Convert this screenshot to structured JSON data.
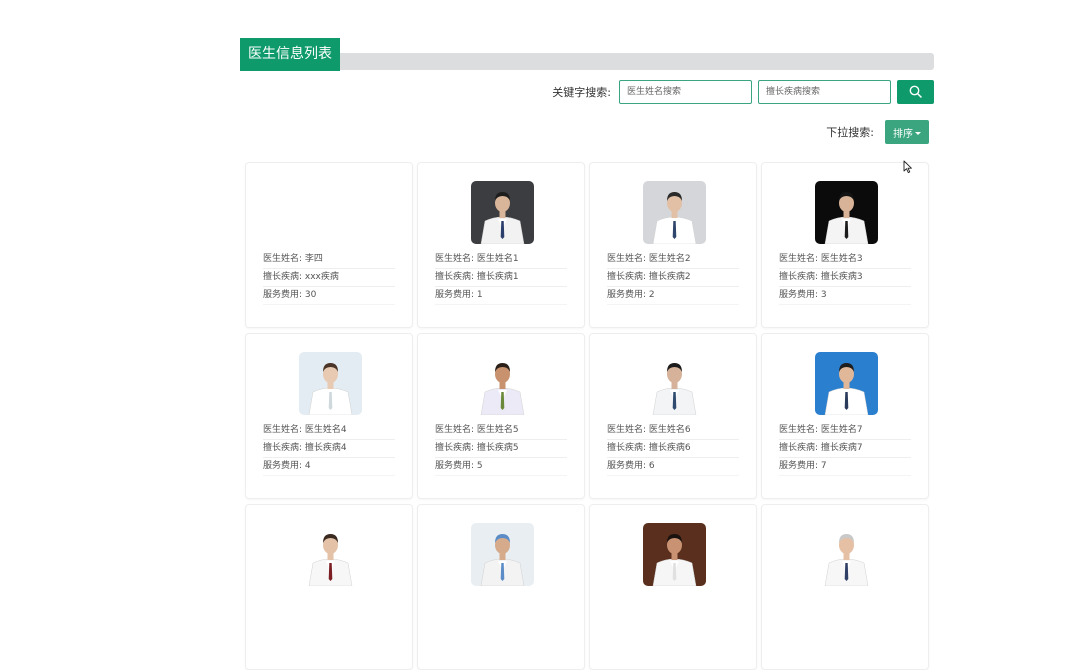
{
  "header": {
    "title": "医生信息列表"
  },
  "search": {
    "label": "关键字搜索:",
    "name_placeholder": "医生姓名搜索",
    "disease_placeholder": "擅长疾病搜索",
    "button_icon": "search-icon"
  },
  "dropdown": {
    "label": "下拉搜索:",
    "sort_label": "排序"
  },
  "doctors": [
    {
      "name": "医生姓名: 李四",
      "disease": "擅长疾病: xxx疾病",
      "fee": "服务费用: 30",
      "photo": "none"
    },
    {
      "name": "医生姓名: 医生姓名1",
      "disease": "擅长疾病: 擅长疾病1",
      "fee": "服务费用: 1",
      "photo": "doctor-photo"
    },
    {
      "name": "医生姓名: 医生姓名2",
      "disease": "擅长疾病: 擅长疾病2",
      "fee": "服务费用: 2",
      "photo": "doctor-photo"
    },
    {
      "name": "医生姓名: 医生姓名3",
      "disease": "擅长疾病: 擅长疾病3",
      "fee": "服务费用: 3",
      "photo": "doctor-photo"
    },
    {
      "name": "医生姓名: 医生姓名4",
      "disease": "擅长疾病: 擅长疾病4",
      "fee": "服务费用: 4",
      "photo": "doctor-photo"
    },
    {
      "name": "医生姓名: 医生姓名5",
      "disease": "擅长疾病: 擅长疾病5",
      "fee": "服务费用: 5",
      "photo": "doctor-photo"
    },
    {
      "name": "医生姓名: 医生姓名6",
      "disease": "擅长疾病: 擅长疾病6",
      "fee": "服务费用: 6",
      "photo": "doctor-photo"
    },
    {
      "name": "医生姓名: 医生姓名7",
      "disease": "擅长疾病: 擅长疾病7",
      "fee": "服务费用: 7",
      "photo": "doctor-photo"
    },
    {
      "name": "",
      "disease": "",
      "fee": "",
      "photo": "doctor-photo"
    },
    {
      "name": "",
      "disease": "",
      "fee": "",
      "photo": "doctor-photo"
    },
    {
      "name": "",
      "disease": "",
      "fee": "",
      "photo": "doctor-photo"
    },
    {
      "name": "",
      "disease": "",
      "fee": "",
      "photo": "doctor-photo"
    }
  ],
  "colors": {
    "accent": "#0f9a6c",
    "accent_light": "#3aa57f",
    "header_bar": "#dcdddf"
  }
}
